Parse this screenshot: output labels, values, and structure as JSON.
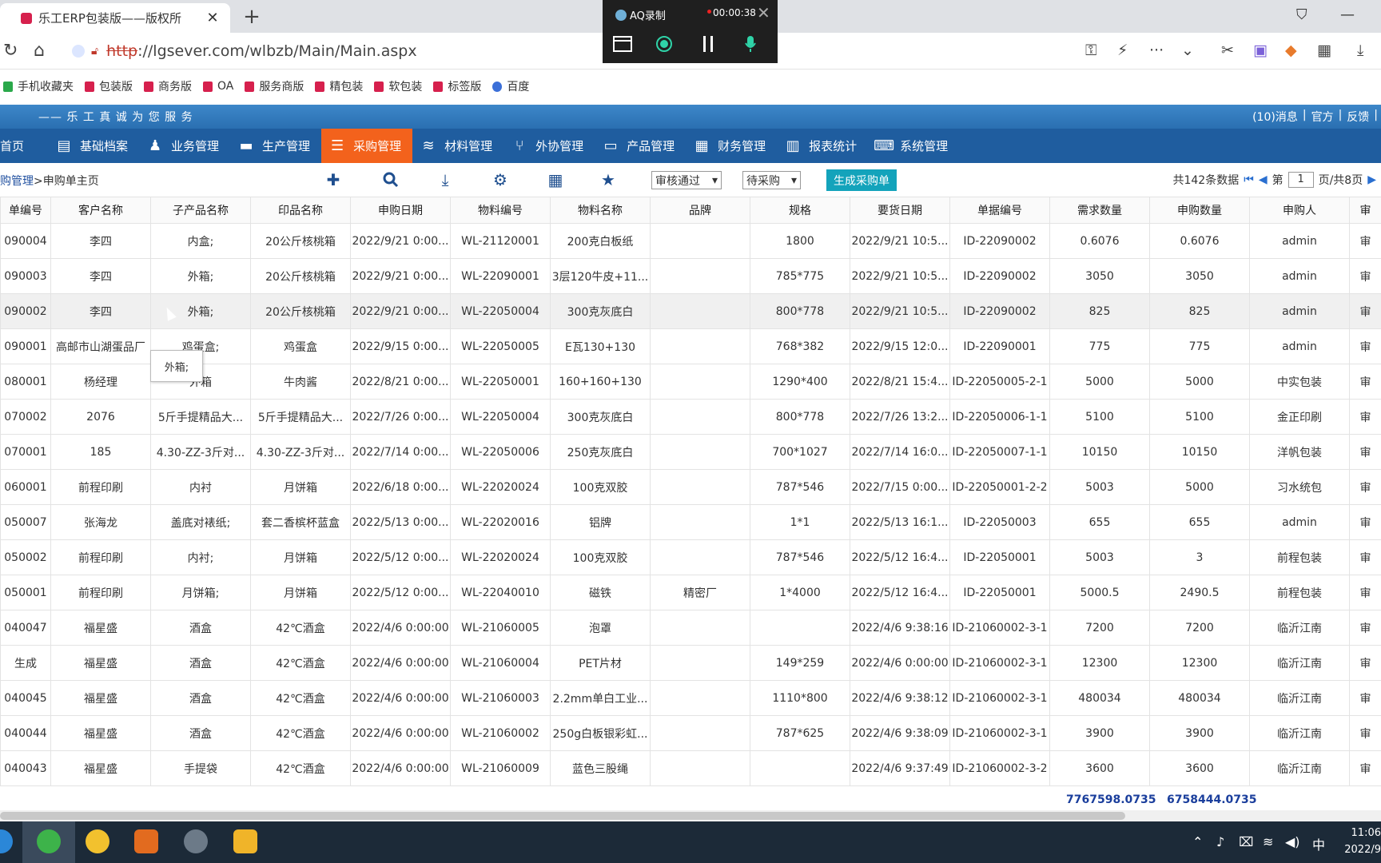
{
  "browser": {
    "tab_title": "乐工ERP包装版——版权所",
    "tab_close": "✕",
    "new_tab": "+",
    "url_scheme": "http",
    "url_rest": "://lgsever.com/wlbzb/Main/Main.aspx"
  },
  "recorder": {
    "title": "AQ录制",
    "time": "00:00:38"
  },
  "bookmarks": [
    {
      "label": "手机收藏夹"
    },
    {
      "label": "包装版"
    },
    {
      "label": "商务版"
    },
    {
      "label": "OA"
    },
    {
      "label": "服务商版"
    },
    {
      "label": "精包装"
    },
    {
      "label": "软包装"
    },
    {
      "label": "标签版"
    },
    {
      "label": "百度"
    }
  ],
  "header": {
    "slogan": "—— 乐 工 真 诚 为 您 服 务",
    "messages": "(10)消息",
    "official": "官方",
    "feedback": "反馈"
  },
  "menu": [
    {
      "label": "首页"
    },
    {
      "label": "基础档案"
    },
    {
      "label": "业务管理"
    },
    {
      "label": "生产管理"
    },
    {
      "label": "采购管理"
    },
    {
      "label": "材料管理"
    },
    {
      "label": "外协管理"
    },
    {
      "label": "产品管理"
    },
    {
      "label": "财务管理"
    },
    {
      "label": "报表统计"
    },
    {
      "label": "系统管理"
    }
  ],
  "toolbar": {
    "crumb_parent": "购管理",
    "crumb_sep": ">",
    "crumb_current": "申购单主页",
    "filter_status": "审核通过",
    "filter_purchase": "待采购",
    "generate_label": "生成采购单",
    "total_records": "共142条数据",
    "page_prefix": "第",
    "page_value": "1",
    "page_suffix": "页/共8页"
  },
  "table": {
    "columns": [
      "单编号",
      "客户名称",
      "子产品名称",
      "印品名称",
      "申购日期",
      "物料编号",
      "物料名称",
      "品牌",
      "规格",
      "要货日期",
      "单据编号",
      "需求数量",
      "申购数量",
      "申购人",
      "审"
    ],
    "rows": [
      [
        "090004",
        "李四",
        "内盒;",
        "20公斤核桃箱",
        "2022/9/21 0:00...",
        "WL-21120001",
        "200克白板纸",
        "",
        "1800",
        "2022/9/21 10:5...",
        "ID-22090002",
        "0.6076",
        "0.6076",
        "admin",
        "审"
      ],
      [
        "090003",
        "李四",
        "外箱;",
        "20公斤核桃箱",
        "2022/9/21 0:00...",
        "WL-22090001",
        "3层120牛皮+11...",
        "",
        "785*775",
        "2022/9/21 10:5...",
        "ID-22090002",
        "3050",
        "3050",
        "admin",
        "审"
      ],
      [
        "090002",
        "李四",
        "外箱;",
        "20公斤核桃箱",
        "2022/9/21 0:00...",
        "WL-22050004",
        "300克灰底白",
        "",
        "800*778",
        "2022/9/21 10:5...",
        "ID-22090002",
        "825",
        "825",
        "admin",
        "审"
      ],
      [
        "090001",
        "高邮市山湖蛋品厂",
        "鸡蛋盒;",
        "鸡蛋盒",
        "2022/9/15 0:00...",
        "WL-22050005",
        "E瓦130+130",
        "",
        "768*382",
        "2022/9/15 12:0...",
        "ID-22090001",
        "775",
        "775",
        "admin",
        "审"
      ],
      [
        "080001",
        "杨经理",
        "外箱",
        "牛肉酱",
        "2022/8/21 0:00...",
        "WL-22050001",
        "160+160+130",
        "",
        "1290*400",
        "2022/8/21 15:4...",
        "ID-22050005-2-1",
        "5000",
        "5000",
        "中实包装",
        "审"
      ],
      [
        "070002",
        "2076",
        "5斤手提精品大...",
        "5斤手提精品大...",
        "2022/7/26 0:00...",
        "WL-22050004",
        "300克灰底白",
        "",
        "800*778",
        "2022/7/26 13:2...",
        "ID-22050006-1-1",
        "5100",
        "5100",
        "金正印刷",
        "审"
      ],
      [
        "070001",
        "185",
        "4.30-ZZ-3斤对...",
        "4.30-ZZ-3斤对...",
        "2022/7/14 0:00...",
        "WL-22050006",
        "250克灰底白",
        "",
        "700*1027",
        "2022/7/14 16:0...",
        "ID-22050007-1-1",
        "10150",
        "10150",
        "洋帆包装",
        "审"
      ],
      [
        "060001",
        "前程印刷",
        "内衬",
        "月饼箱",
        "2022/6/18 0:00...",
        "WL-22020024",
        "100克双胶",
        "",
        "787*546",
        "2022/7/15 0:00...",
        "ID-22050001-2-2",
        "5003",
        "5000",
        "习水统包",
        "审"
      ],
      [
        "050007",
        "张海龙",
        "盖底对裱纸;",
        "套二香槟杯蓝盒",
        "2022/5/13 0:00...",
        "WL-22020016",
        "铝牌",
        "",
        "1*1",
        "2022/5/13 16:1...",
        "ID-22050003",
        "655",
        "655",
        "admin",
        "审"
      ],
      [
        "050002",
        "前程印刷",
        "内衬;",
        "月饼箱",
        "2022/5/12 0:00...",
        "WL-22020024",
        "100克双胶",
        "",
        "787*546",
        "2022/5/12 16:4...",
        "ID-22050001",
        "5003",
        "3",
        "前程包装",
        "审"
      ],
      [
        "050001",
        "前程印刷",
        "月饼箱;",
        "月饼箱",
        "2022/5/12 0:00...",
        "WL-22040010",
        "磁铁",
        "精密厂",
        "1*4000",
        "2022/5/12 16:4...",
        "ID-22050001",
        "5000.5",
        "2490.5",
        "前程包装",
        "审"
      ],
      [
        "040047",
        "福星盛",
        "酒盒",
        "42℃酒盒",
        "2022/4/6 0:00:00",
        "WL-21060005",
        "泡罩",
        "",
        "",
        "2022/4/6 9:38:16",
        "ID-21060002-3-1",
        "7200",
        "7200",
        "临沂江南",
        "审"
      ],
      [
        "生成",
        "福星盛",
        "酒盒",
        "42℃酒盒",
        "2022/4/6 0:00:00",
        "WL-21060004",
        "PET片材",
        "",
        "149*259",
        "2022/4/6 0:00:00",
        "ID-21060002-3-1",
        "12300",
        "12300",
        "临沂江南",
        "审"
      ],
      [
        "040045",
        "福星盛",
        "酒盒",
        "42℃酒盒",
        "2022/4/6 0:00:00",
        "WL-21060003",
        "2.2mm单白工业...",
        "",
        "1110*800",
        "2022/4/6 9:38:12",
        "ID-21060002-3-1",
        "480034",
        "480034",
        "临沂江南",
        "审"
      ],
      [
        "040044",
        "福星盛",
        "酒盒",
        "42℃酒盒",
        "2022/4/6 0:00:00",
        "WL-21060002",
        "250g白板银彩虹...",
        "",
        "787*625",
        "2022/4/6 9:38:09",
        "ID-21060002-3-1",
        "3900",
        "3900",
        "临沂江南",
        "审"
      ],
      [
        "040043",
        "福星盛",
        "手提袋",
        "42℃酒盒",
        "2022/4/6 0:00:00",
        "WL-21060009",
        "蓝色三股绳",
        "",
        "",
        "2022/4/6 9:37:49",
        "ID-21060002-3-2",
        "3600",
        "3600",
        "临沂江南",
        "审"
      ]
    ]
  },
  "tooltip": "外箱;",
  "totals": {
    "demand": "7767598.0735",
    "purchase": "6758444.0735"
  },
  "taskbar": {
    "time": "11:06",
    "date": "2022/9",
    "ime": "中"
  }
}
